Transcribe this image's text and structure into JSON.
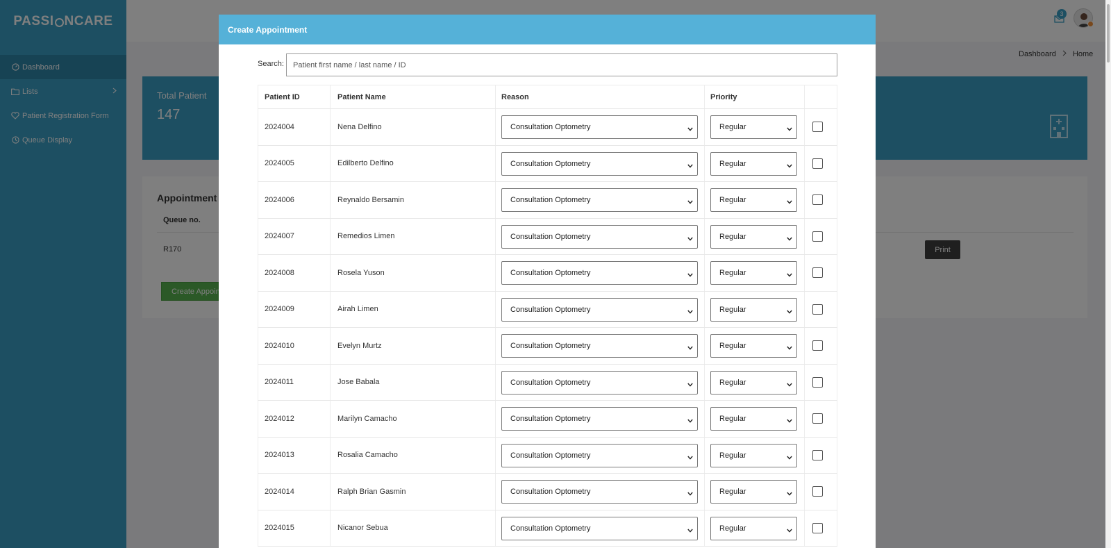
{
  "app": {
    "logo_prefix": "PASSI",
    "logo_suffix": "NCARE"
  },
  "sidebar": {
    "items": [
      {
        "label": "Dashboard",
        "icon": "dashboard-icon",
        "active": true
      },
      {
        "label": "Lists",
        "icon": "folder-icon",
        "has_submenu": true
      },
      {
        "label": "Patient Registration Form",
        "icon": "heart-icon"
      },
      {
        "label": "Queue Display",
        "icon": "clock-icon"
      }
    ]
  },
  "topbar": {
    "notification_count": "3"
  },
  "breadcrumb": {
    "items": [
      "Dashboard",
      "Home"
    ]
  },
  "stats": {
    "total_patient_label": "Total Patient",
    "total_patient_value": "147"
  },
  "appointments": {
    "title": "Appointment S",
    "queue_header": "Queue no.",
    "queue_value": "R170",
    "create_button": "Create Appoint",
    "print_button": "Print"
  },
  "modal": {
    "title": "Create Appointment",
    "search_label": "Search:",
    "search_placeholder": "Patient first name / last name / ID",
    "columns": [
      "Patient ID",
      "Patient Name",
      "Reason",
      "Priority"
    ],
    "rows": [
      {
        "id": "2024004",
        "name": "Nena Delfino",
        "reason": "Consultation Optometry",
        "priority": "Regular",
        "checked": false
      },
      {
        "id": "2024005",
        "name": "Edilberto Delfino",
        "reason": "Consultation Optometry",
        "priority": "Regular",
        "checked": false
      },
      {
        "id": "2024006",
        "name": "Reynaldo Bersamin",
        "reason": "Consultation Optometry",
        "priority": "Regular",
        "checked": false
      },
      {
        "id": "2024007",
        "name": "Remedios Limen",
        "reason": "Consultation Optometry",
        "priority": "Regular",
        "checked": false
      },
      {
        "id": "2024008",
        "name": "Rosela Yuson",
        "reason": "Consultation Optometry",
        "priority": "Regular",
        "checked": false
      },
      {
        "id": "2024009",
        "name": "Airah Limen",
        "reason": "Consultation Optometry",
        "priority": "Regular",
        "checked": false
      },
      {
        "id": "2024010",
        "name": "Evelyn Murtz",
        "reason": "Consultation Optometry",
        "priority": "Regular",
        "checked": false
      },
      {
        "id": "2024011",
        "name": "Jose Babala",
        "reason": "Consultation Optometry",
        "priority": "Regular",
        "checked": false
      },
      {
        "id": "2024012",
        "name": "Marilyn Camacho",
        "reason": "Consultation Optometry",
        "priority": "Regular",
        "checked": false
      },
      {
        "id": "2024013",
        "name": "Rosalia Camacho",
        "reason": "Consultation Optometry",
        "priority": "Regular",
        "checked": false
      },
      {
        "id": "2024014",
        "name": "Ralph Brian Gasmin",
        "reason": "Consultation Optometry",
        "priority": "Regular",
        "checked": false
      },
      {
        "id": "2024015",
        "name": "Nicanor Sebua",
        "reason": "Consultation Optometry",
        "priority": "Regular",
        "checked": false
      }
    ]
  },
  "colors": {
    "sidebar_bg": "#3a9fc5",
    "modal_header": "#55b1d8",
    "create_button": "#57b24f",
    "print_button": "#3e3e3e"
  }
}
